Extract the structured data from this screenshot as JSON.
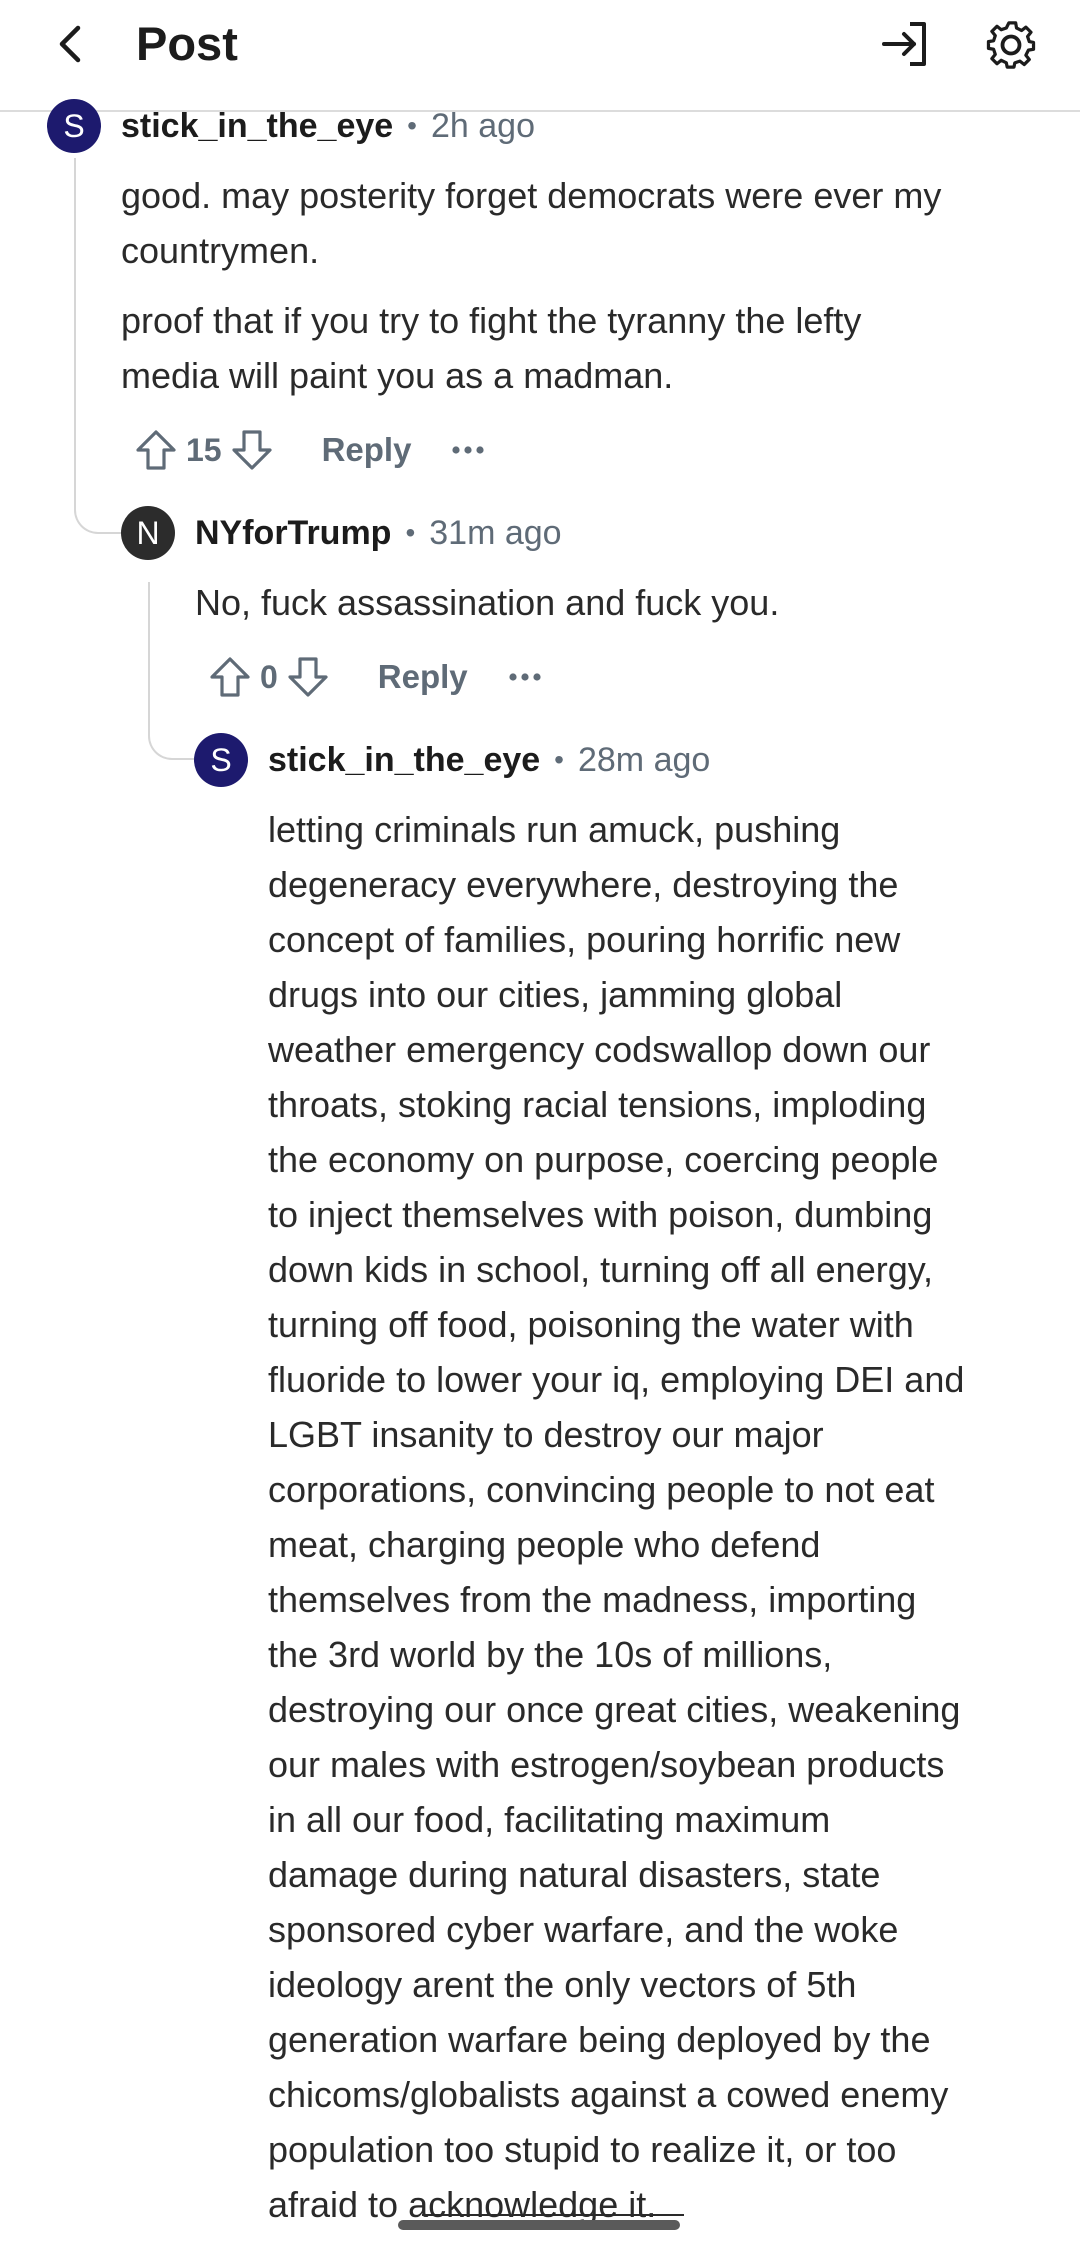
{
  "header": {
    "title": "Post"
  },
  "comments": [
    {
      "avatar_letter": "S",
      "author": "stick_in_the_eye",
      "separator": "•",
      "time": "2h ago",
      "paragraphs": [
        [
          "good. may posterity forget democrats were ever my",
          "countrymen."
        ],
        [
          "proof that if you try to fight the tyranny the lefty",
          "media will paint you as a madman."
        ]
      ],
      "score": "15",
      "reply_label": "Reply"
    },
    {
      "avatar_letter": "N",
      "author": "NYforTrump",
      "separator": "•",
      "time": "31m ago",
      "paragraphs": [
        [
          "No, fuck assassination and fuck you."
        ]
      ],
      "score": "0",
      "reply_label": "Reply"
    },
    {
      "avatar_letter": "S",
      "author": "stick_in_the_eye",
      "separator": "•",
      "time": "28m ago",
      "paragraphs": [
        [
          "letting criminals run amuck, pushing",
          "degeneracy everywhere, destroying the",
          "concept of families, pouring horrific new",
          "drugs into our cities, jamming global",
          "weather emergency codswallop down our",
          "throats, stoking racial tensions, imploding",
          "the economy on purpose, coercing people",
          "to inject themselves with poison, dumbing",
          "down kids in school, turning off all energy,",
          "turning off food, poisoning the water with",
          "fluoride to lower your iq, employing DEI and",
          "LGBT insanity to destroy our major",
          "corporations, convincing people to not eat",
          "meat, charging people who defend",
          "themselves from the madness, importing",
          "the 3rd world by the 10s of millions,",
          "destroying our once great cities, weakening",
          "our males with estrogen/soybean products",
          "in all our food, facilitating maximum",
          "damage during natural disasters, state",
          "sponsored cyber warfare, and the woke",
          "ideology arent the only vectors of 5th",
          "generation warfare being deployed by the",
          "chicoms/globalists against a cowed enemy",
          "population too stupid to realize it, or too",
          "afraid to acknowledge it."
        ]
      ]
    }
  ],
  "colors": {
    "avatar_s": "#1d1a6e",
    "avatar_n": "#2c2c2c",
    "meta_gray": "#5f6b77",
    "thread_line": "#d6d6d6"
  },
  "icons": [
    "back-arrow-icon",
    "login-icon",
    "gear-icon",
    "upvote-icon",
    "downvote-icon",
    "more-icon"
  ]
}
